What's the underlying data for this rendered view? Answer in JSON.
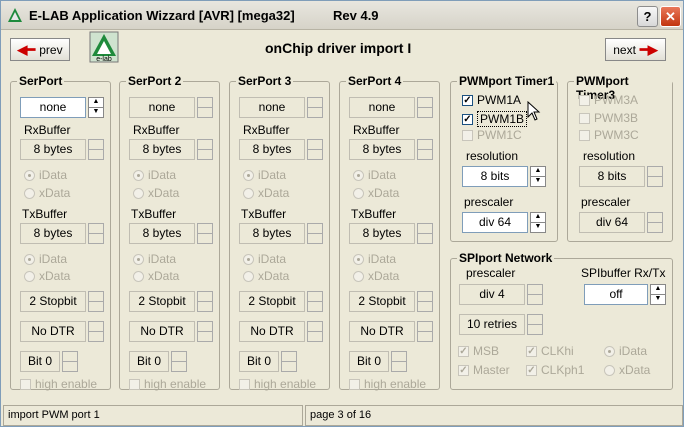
{
  "window": {
    "title": "E-LAB Application Wizzard [AVR] [mega32]",
    "rev": "Rev 4.9",
    "help_glyph": "?",
    "close_glyph": "✕"
  },
  "nav": {
    "prev_label": "prev",
    "next_label": "next",
    "logo_text": "e-lab",
    "page_title": "onChip driver import I"
  },
  "serports": [
    {
      "title": "SerPort",
      "mode": "none",
      "mode_enabled": true,
      "rx_label": "RxBuffer",
      "rx": "8 bytes",
      "rx_opt1": "iData",
      "rx_opt2": "xData",
      "tx_label": "TxBuffer",
      "tx": "8 bytes",
      "tx_opt1": "iData",
      "tx_opt2": "xData",
      "stop": "2 Stopbit",
      "dtr": "No DTR",
      "bit": "Bit 0",
      "high": "high enable"
    },
    {
      "title": "SerPort 2",
      "mode": "none",
      "mode_enabled": false,
      "rx_label": "RxBuffer",
      "rx": "8 bytes",
      "rx_opt1": "iData",
      "rx_opt2": "xData",
      "tx_label": "TxBuffer",
      "tx": "8 bytes",
      "tx_opt1": "iData",
      "tx_opt2": "xData",
      "stop": "2 Stopbit",
      "dtr": "No DTR",
      "bit": "Bit 0",
      "high": "high enable"
    },
    {
      "title": "SerPort 3",
      "mode": "none",
      "mode_enabled": false,
      "rx_label": "RxBuffer",
      "rx": "8 bytes",
      "rx_opt1": "iData",
      "rx_opt2": "xData",
      "tx_label": "TxBuffer",
      "tx": "8 bytes",
      "tx_opt1": "iData",
      "tx_opt2": "xData",
      "stop": "2 Stopbit",
      "dtr": "No DTR",
      "bit": "Bit 0",
      "high": "high enable"
    },
    {
      "title": "SerPort 4",
      "mode": "none",
      "mode_enabled": false,
      "rx_label": "RxBuffer",
      "rx": "8 bytes",
      "rx_opt1": "iData",
      "rx_opt2": "xData",
      "tx_label": "TxBuffer",
      "tx": "8 bytes",
      "tx_opt1": "iData",
      "tx_opt2": "xData",
      "stop": "2 Stopbit",
      "dtr": "No DTR",
      "bit": "Bit 0",
      "high": "high enable"
    }
  ],
  "pwm1": {
    "title": "PWMport Timer1",
    "a": "PWM1A",
    "b": "PWM1B",
    "c": "PWM1C",
    "res_label": "resolution",
    "res": "8 bits",
    "pre_label": "prescaler",
    "pre": "div 64"
  },
  "pwm3": {
    "title": "PWMport Timer3",
    "a": "PWM3A",
    "b": "PWM3B",
    "c": "PWM3C",
    "res_label": "resolution",
    "res": "8 bits",
    "pre_label": "prescaler",
    "pre": "div 64"
  },
  "spi": {
    "title": "SPIport Network",
    "pre_label": "prescaler",
    "pre": "div 4",
    "buf_label": "SPIbuffer Rx/Tx",
    "buf": "off",
    "retries": "10 retries",
    "msb": "MSB",
    "clkhi": "CLKhi",
    "idata": "iData",
    "master": "Master",
    "clkph": "CLKph1",
    "xdata": "xData"
  },
  "status": {
    "left": "import PWM port 1",
    "right": "page 3 of 16"
  },
  "arrows": {
    "up": "▲",
    "down": "▼",
    "check": "✓"
  }
}
